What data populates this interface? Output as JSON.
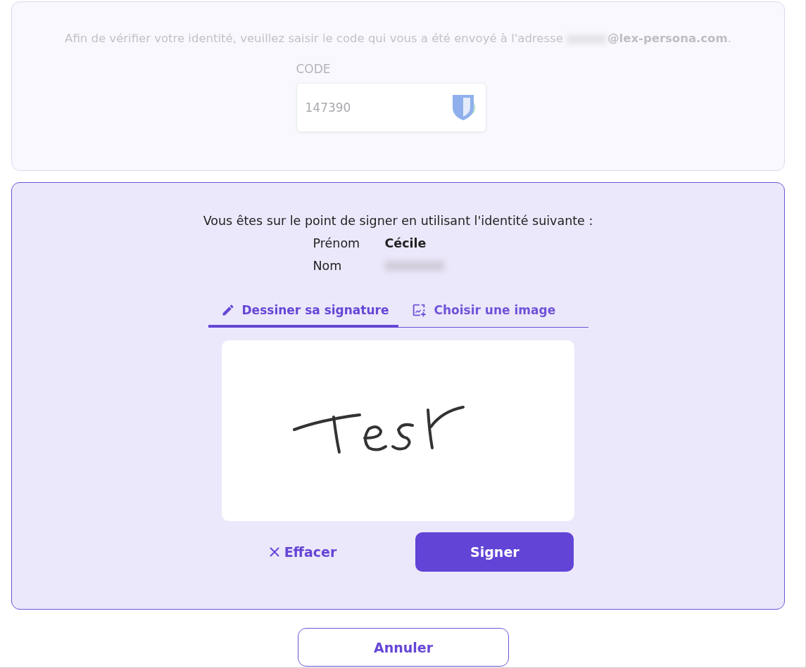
{
  "verification": {
    "disabled": true,
    "message_start": "Afin de vérifier votre identité, veuillez saisir le code qui vous a été envoyé à l'adresse",
    "email_domain": "@lex-persona.com",
    "message_end": ".",
    "code_label": "CODE",
    "code_value": "147390"
  },
  "identity": {
    "intro": "Vous êtes sur le point de signer en utilisant l'identité suivante :",
    "fields": [
      {
        "label": "Prénom",
        "value": "Cécile"
      },
      {
        "label": "Nom"
      }
    ]
  },
  "tabs": [
    {
      "label": "Dessiner sa signature",
      "kind": "draw",
      "selected": true
    },
    {
      "label": "Choisir une image",
      "kind": "image",
      "selected": false
    }
  ],
  "actions": {
    "clear": "Effacer",
    "sign": "Signer"
  },
  "cancel": "Annuler"
}
